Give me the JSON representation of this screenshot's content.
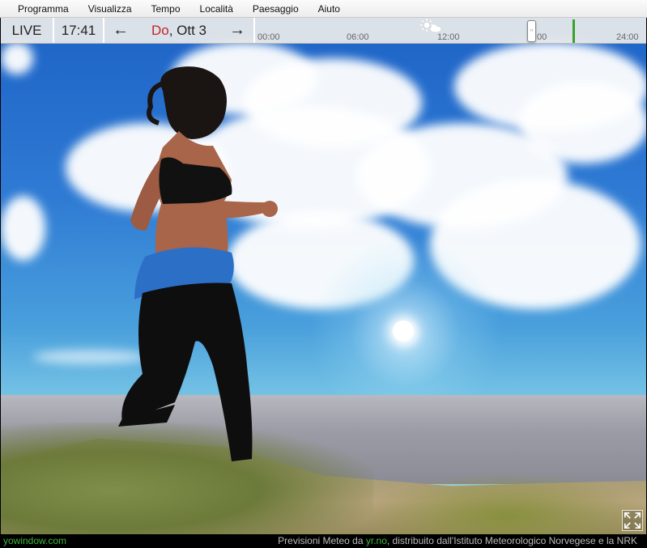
{
  "menu": {
    "items": [
      "Programma",
      "Visualizza",
      "Tempo",
      "Località",
      "Paesaggio",
      "Aiuto"
    ]
  },
  "toolbar": {
    "live_label": "LIVE",
    "time": "17:41",
    "date_day": "Do",
    "date_rest": ", Ott 3",
    "timeline_labels": [
      "00:00",
      "06:00",
      "12:00",
      ":00",
      "24:00"
    ],
    "handle_glyph": "‹›"
  },
  "status": {
    "brand": "yowindow.com",
    "credit_prefix": "Previsioni Meteo da ",
    "credit_link": "yr.no",
    "credit_suffix": ", distribuito dall'Istituto Meteorologico Norvegese e la NRK"
  },
  "icons": {
    "prev": "arrow-left-icon",
    "next": "arrow-right-icon",
    "weather": "sun-cloud-icon",
    "expand": "fullscreen-icon"
  },
  "colors": {
    "brand_green": "#3db53d",
    "day_red": "#c0282a",
    "marker_green": "#3aa12b"
  }
}
